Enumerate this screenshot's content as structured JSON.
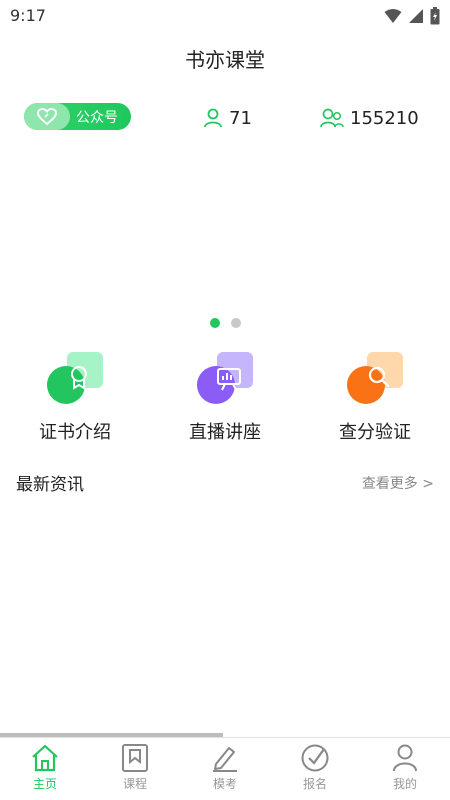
{
  "status_bar": {
    "time": "9:17"
  },
  "header": {
    "title": "书亦课堂"
  },
  "wechat_button": {
    "label": "公众号"
  },
  "stats": [
    {
      "icon": "user-icon",
      "value": "71"
    },
    {
      "icon": "users-icon",
      "value": "155210"
    }
  ],
  "carousel": {
    "total": 2,
    "active_index": 0
  },
  "features": [
    {
      "label": "证书介绍",
      "icon": "certificate-icon",
      "color": "#22c55e"
    },
    {
      "label": "直播讲座",
      "icon": "presentation-icon",
      "color": "#8b5cf6"
    },
    {
      "label": "查分验证",
      "icon": "search-icon",
      "color": "#f97316"
    }
  ],
  "news": {
    "title": "最新资讯",
    "more_label": "查看更多 >"
  },
  "tabs": [
    {
      "label": "主页",
      "icon": "home-icon",
      "active": true
    },
    {
      "label": "课程",
      "icon": "bookmark-icon",
      "active": false
    },
    {
      "label": "模考",
      "icon": "pencil-icon",
      "active": false
    },
    {
      "label": "报名",
      "icon": "check-circle-icon",
      "active": false
    },
    {
      "label": "我的",
      "icon": "person-icon",
      "active": false
    }
  ],
  "colors": {
    "accent": "#22c55e",
    "inactive": "#999999"
  }
}
